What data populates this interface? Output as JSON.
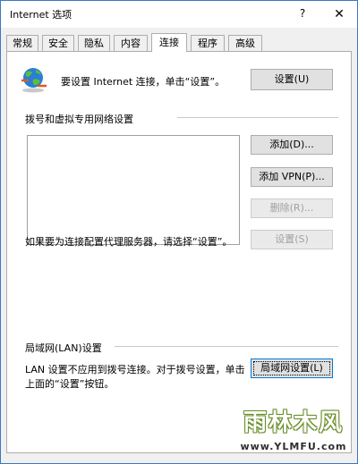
{
  "window": {
    "title": "Internet 选项",
    "help_glyph": "?",
    "close_glyph": "✕"
  },
  "tabs": [
    {
      "label": "常规"
    },
    {
      "label": "安全"
    },
    {
      "label": "隐私"
    },
    {
      "label": "内容"
    },
    {
      "label": "连接",
      "active": true
    },
    {
      "label": "程序"
    },
    {
      "label": "高级"
    }
  ],
  "setup": {
    "icon": "globe-network-icon",
    "text": "要设置 Internet 连接，单击“设置”。",
    "button": "设置(U)"
  },
  "dialup": {
    "group_title": "拨号和虚拟专用网络设置",
    "add_button": "添加(D)...",
    "add_vpn_button": "添加 VPN(P)...",
    "remove_button": "删除(R)...",
    "settings_button": "设置(S)",
    "proxy_note": "如果要为连接配置代理服务器，请选择“设置”。"
  },
  "lan": {
    "group_title": "局域网(LAN)设置",
    "note_line1": "LAN 设置不应用到拨号连接。对于拨号设置，单击",
    "note_line2": "上面的“设置”按钮。",
    "button": "局域网设置(L)"
  },
  "watermark": {
    "title": "雨林木风",
    "url": "www.YLMFU.com"
  },
  "colors": {
    "window_border": "#3a78c2",
    "focus_border": "#0078d7",
    "disabled_text": "#a0a0a0",
    "watermark_green": "#6a8f2a"
  }
}
